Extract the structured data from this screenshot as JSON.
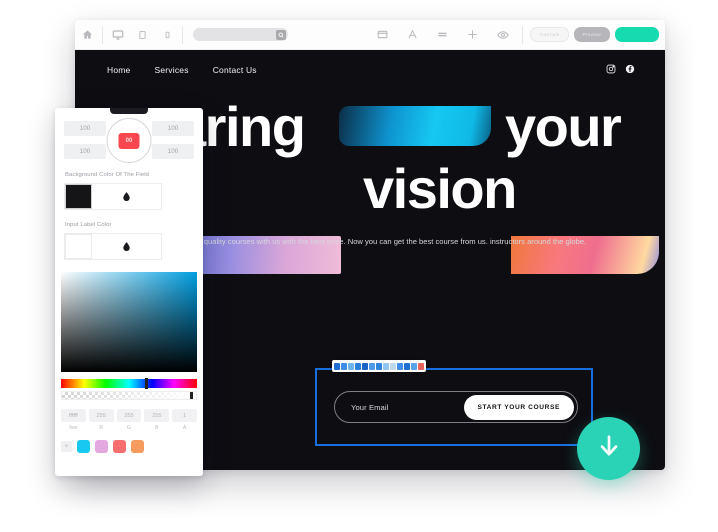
{
  "builder": {
    "toolbar": {
      "icons": [
        "home-icon",
        "desktop-icon",
        "tablet-icon",
        "mobile-icon"
      ],
      "search_placeholder": "",
      "right_icons": [
        "card-icon",
        "text-icon",
        "section-icon",
        "move-icon",
        "eye-icon"
      ],
      "buttons": [
        {
          "label": "Tutorials",
          "style": "outline"
        },
        {
          "label": "Preview",
          "style": "grey"
        },
        {
          "label": "",
          "style": "green"
        }
      ]
    }
  },
  "site": {
    "nav": {
      "links": [
        "Home",
        "Services",
        "Contact Us"
      ],
      "social": [
        "instagram-icon",
        "facebook-icon"
      ]
    },
    "hero": {
      "line1_word1": "aring",
      "line1_word2": "your",
      "line2_word1": "vision",
      "paragraph": "quality courses with us with the best price. Now you can get the best course from us. instructors around the globe."
    },
    "form": {
      "email_placeholder": "Your Email",
      "cta_label": "START YOUR COURSE"
    },
    "fab": {
      "icon": "download-arrow-icon",
      "color": "#2ad3b5"
    }
  },
  "picker": {
    "numbers": {
      "top_left": "100",
      "top_right": "100",
      "bottom_left": "100",
      "bottom_right": "100"
    },
    "dial_label": "00",
    "dial_color": "#f8474f",
    "fields": [
      {
        "label": "Background Color Of The Field",
        "swatch": "#151518",
        "icon": "droplet-icon"
      },
      {
        "label": "Input Label Color",
        "swatch": "#ffffff",
        "icon": "droplet-icon"
      }
    ],
    "values": [
      {
        "value": "ffffff",
        "caption": "hex"
      },
      {
        "value": "255",
        "caption": "R"
      },
      {
        "value": "255",
        "caption": "G"
      },
      {
        "value": "255",
        "caption": "B"
      },
      {
        "value": "1",
        "caption": "A"
      }
    ],
    "presets": [
      "#18c8f0",
      "#e3a8e0",
      "#f76f6f",
      "#f79a5e"
    ],
    "preset_add_label": "+"
  }
}
